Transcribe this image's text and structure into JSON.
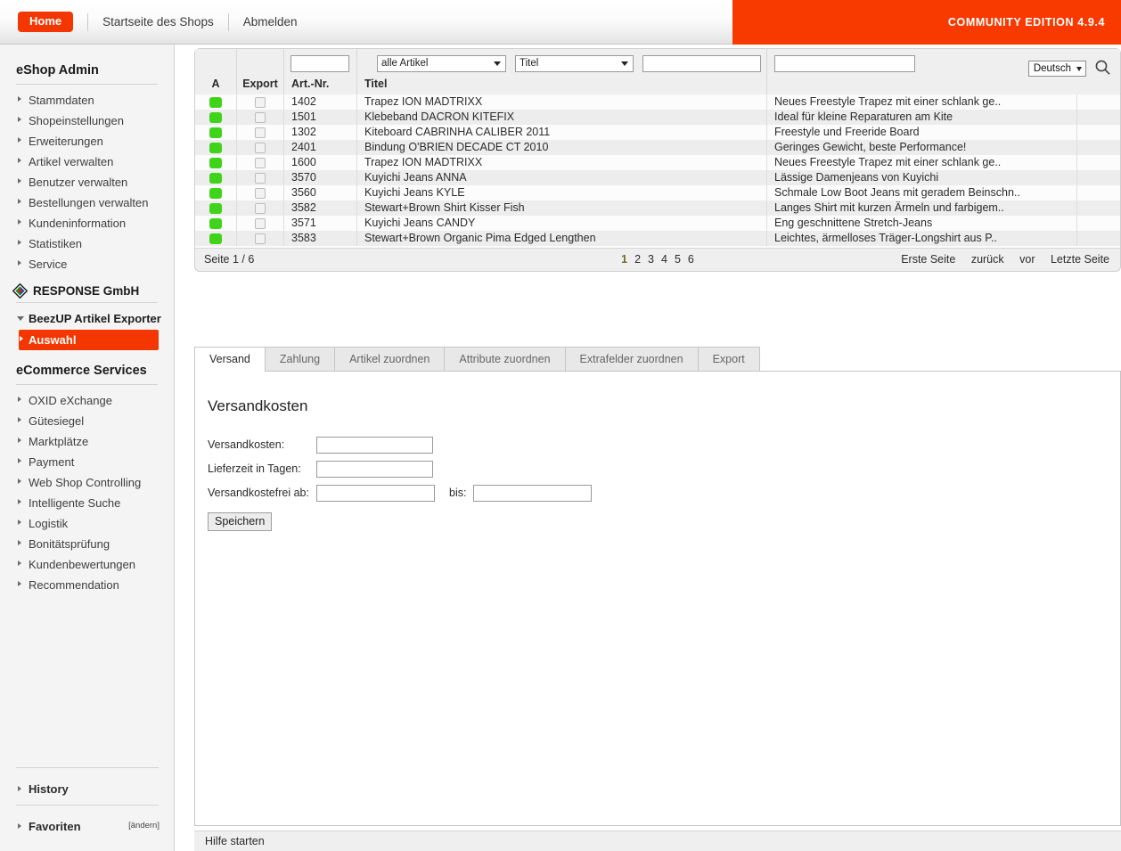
{
  "topbar": {
    "home_label": "Home",
    "links": [
      "Startseite des Shops",
      "Abmelden"
    ],
    "version_banner": "COMMUNITY EDITION 4.9.4",
    "accent_color": "#f93a00"
  },
  "sidebar": {
    "admin_title": "eShop Admin",
    "admin_items": [
      {
        "label": "Stammdaten"
      },
      {
        "label": "Shopeinstellungen"
      },
      {
        "label": "Erweiterungen"
      },
      {
        "label": "Artikel verwalten"
      },
      {
        "label": "Benutzer verwalten"
      },
      {
        "label": "Bestellungen verwalten"
      },
      {
        "label": "Kundeninformation"
      },
      {
        "label": "Statistiken"
      },
      {
        "label": "Service"
      }
    ],
    "brand": "RESPONSE GmbH",
    "exporter_group": "BeezUP Artikel Exporter",
    "exporter_selected": "Auswahl",
    "services_title": "eCommerce Services",
    "services_items": [
      {
        "label": "OXID eXchange"
      },
      {
        "label": "Gütesiegel"
      },
      {
        "label": "Marktplätze"
      },
      {
        "label": "Payment"
      },
      {
        "label": "Web Shop Controlling"
      },
      {
        "label": "Intelligente Suche"
      },
      {
        "label": "Logistik"
      },
      {
        "label": "Bonitätsprüfung"
      },
      {
        "label": "Kundenbewertungen"
      },
      {
        "label": "Recommendation"
      }
    ],
    "history_label": "History",
    "favorites_label": "Favoriten",
    "favorites_edit": "[ändern]"
  },
  "list": {
    "columns": {
      "a": "A",
      "export": "Export",
      "artnr": "Art.-Nr.",
      "titel": "Titel"
    },
    "filters": {
      "artnr_value": "",
      "category_value": "alle Artikel",
      "field_value": "Titel",
      "field_text_value": "",
      "desc_text_value": ""
    },
    "language_value": "Deutsch",
    "search_icon": "search-icon",
    "rows": [
      {
        "artnr": "1402",
        "titel": "Trapez ION MADTRIXX",
        "desc": "Neues Freestyle Trapez mit einer schlank ge..",
        "status": "active",
        "export": false
      },
      {
        "artnr": "1501",
        "titel": "Klebeband DACRON KITEFIX",
        "desc": "Ideal für kleine Reparaturen am Kite",
        "status": "active",
        "export": false
      },
      {
        "artnr": "1302",
        "titel": "Kiteboard CABRINHA CALIBER 2011",
        "desc": "Freestyle und Freeride Board",
        "status": "active",
        "export": false
      },
      {
        "artnr": "2401",
        "titel": "Bindung O'BRIEN DECADE CT 2010",
        "desc": "Geringes Gewicht, beste Performance!",
        "status": "active",
        "export": false
      },
      {
        "artnr": "1600",
        "titel": "Trapez ION MADTRIXX",
        "desc": "Neues Freestyle Trapez mit einer schlank ge..",
        "status": "active",
        "export": false
      },
      {
        "artnr": "3570",
        "titel": "Kuyichi Jeans ANNA",
        "desc": "Lässige Damenjeans von Kuyichi",
        "status": "active",
        "export": false
      },
      {
        "artnr": "3560",
        "titel": "Kuyichi Jeans KYLE",
        "desc": "Schmale Low Boot Jeans mit geradem Beinschn..",
        "status": "active",
        "export": false
      },
      {
        "artnr": "3582",
        "titel": "Stewart+Brown Shirt Kisser Fish",
        "desc": "Langes Shirt mit kurzen Ärmeln und farbigem..",
        "status": "active",
        "export": false
      },
      {
        "artnr": "3571",
        "titel": "Kuyichi Jeans CANDY",
        "desc": "Eng geschnittene Stretch-Jeans",
        "status": "active",
        "export": false
      },
      {
        "artnr": "3583",
        "titel": "Stewart+Brown Organic Pima Edged Lengthen",
        "desc": "Leichtes, ärmelloses Träger-Longshirt aus P..",
        "status": "active",
        "export": false
      }
    ],
    "status_color": "#3fd41a"
  },
  "pagination": {
    "page_info": "Seite 1 / 6",
    "pages": [
      "1",
      "2",
      "3",
      "4",
      "5",
      "6"
    ],
    "current_page": "1",
    "first_label": "Erste Seite",
    "prev_label": "zurück",
    "next_label": "vor",
    "last_label": "Letzte Seite"
  },
  "tabs": [
    {
      "label": "Versand",
      "active": true
    },
    {
      "label": "Zahlung",
      "active": false
    },
    {
      "label": "Artikel zuordnen",
      "active": false
    },
    {
      "label": "Attribute zuordnen",
      "active": false
    },
    {
      "label": "Extrafelder zuordnen",
      "active": false
    },
    {
      "label": "Export",
      "active": false
    }
  ],
  "form": {
    "heading": "Versandkosten",
    "fields": {
      "versandkosten_label": "Versandkosten:",
      "versandkosten_value": "",
      "lieferzeit_label": "Lieferzeit in Tagen:",
      "lieferzeit_value": "",
      "kostenfrei_label": "Versandkostefrei ab:",
      "kostenfrei_value": "",
      "bis_label": "bis:",
      "bis_value": ""
    },
    "save_label": "Speichern"
  },
  "helpbar": {
    "label": "Hilfe starten"
  }
}
